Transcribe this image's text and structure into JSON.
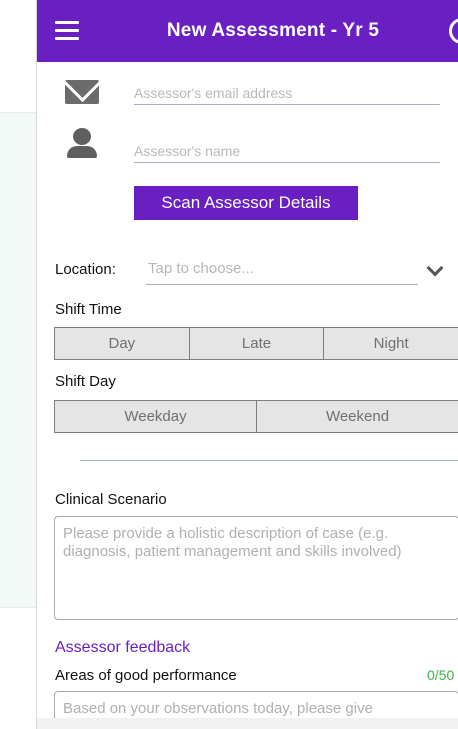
{
  "header": {
    "title": "New Assessment - Yr 5",
    "menu_icon": "hamburger-icon",
    "info_icon": "info-icon"
  },
  "assessor": {
    "email_placeholder": "Assessor's email address",
    "name_placeholder": "Assessor's name",
    "mail_icon": "mail-icon",
    "person_icon": "person-icon",
    "scan_button_label": "Scan Assessor Details"
  },
  "location": {
    "label": "Location:",
    "placeholder": "Tap to choose...",
    "dropdown_icon": "chevron-down-icon"
  },
  "shift_time": {
    "label": "Shift Time",
    "options": [
      "Day",
      "Late",
      "Night"
    ]
  },
  "shift_day": {
    "label": "Shift Day",
    "options": [
      "Weekday",
      "Weekend"
    ]
  },
  "clinical_scenario": {
    "label": "Clinical Scenario",
    "placeholder": "Please provide a holistic description of case (e.g. diagnosis, patient management and skills involved)"
  },
  "feedback": {
    "section_title": "Assessor feedback",
    "areas_good_label": "Areas of good performance",
    "areas_good_counter": "0/50",
    "areas_good_placeholder": "Based on your observations today, please give"
  },
  "colors": {
    "accent": "#6a1fc2",
    "counter": "#3cb34a"
  }
}
